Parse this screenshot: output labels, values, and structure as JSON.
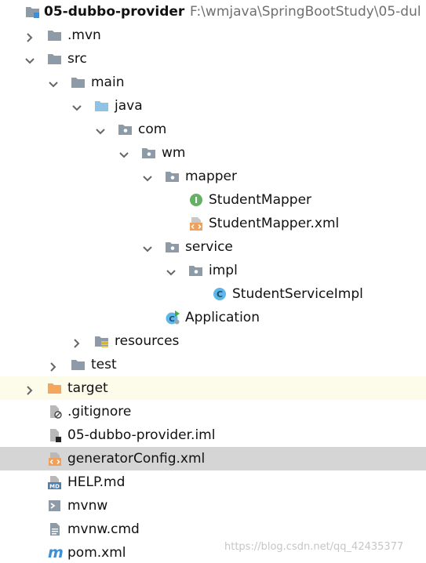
{
  "project": {
    "name": "05-dubbo-provider",
    "path": "F:\\wmjava\\SpringBootStudy\\05-dul"
  },
  "tree": {
    "mvn": ".mvn",
    "src": "src",
    "main": "main",
    "java": "java",
    "com": "com",
    "wm": "wm",
    "mapper": "mapper",
    "student_mapper": "StudentMapper",
    "student_mapper_xml": "StudentMapper.xml",
    "service": "service",
    "impl": "impl",
    "student_service_impl": "StudentServiceImpl",
    "application": "Application",
    "resources": "resources",
    "test": "test",
    "target": "target",
    "gitignore": ".gitignore",
    "iml": "05-dubbo-provider.iml",
    "generator_config": "generatorConfig.xml",
    "help_md": "HELP.md",
    "mvnw": "mvnw",
    "mvnw_cmd": "mvnw.cmd",
    "pom": "pom.xml"
  },
  "icon_letters": {
    "interface": "I",
    "class": "C",
    "md": "MD",
    "maven": "m"
  },
  "watermark": "https://blog.csdn.net/qq_42435377",
  "colors": {
    "folder": "#8d9aa7",
    "source_folder": "#8fc3e6",
    "excluded_folder": "#f5a65b",
    "interface_icon": "#66b066",
    "class_icon": "#5fb7e8",
    "xml_icon": "#f0a058",
    "selected_row": "#d5d5d5",
    "excluded_row": "#fdfbe9"
  }
}
